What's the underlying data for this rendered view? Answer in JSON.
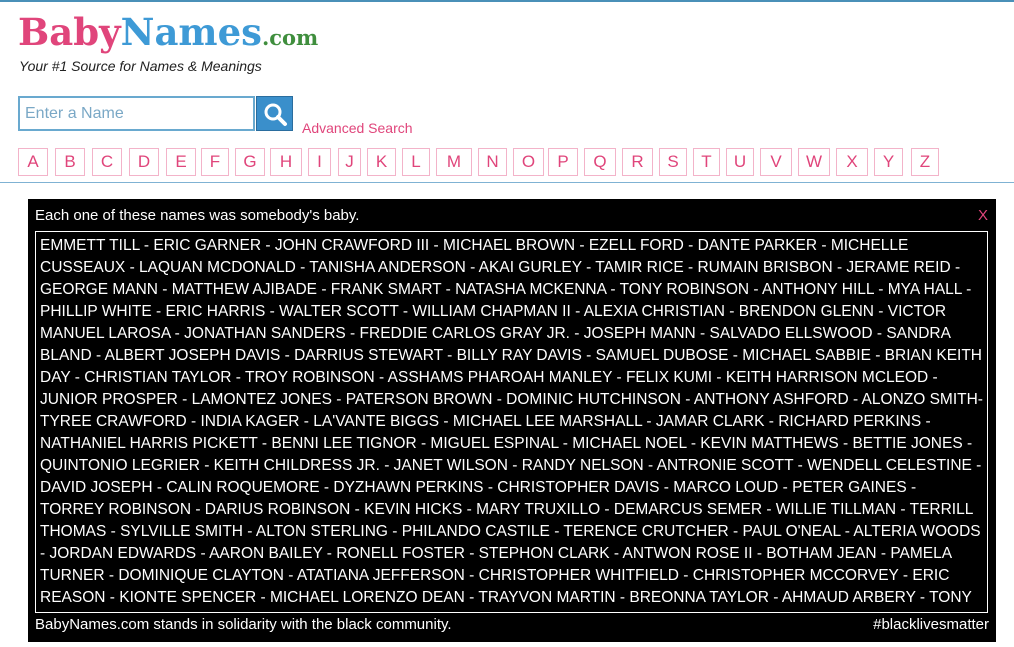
{
  "site": {
    "logo_baby": "Baby",
    "logo_names": "Names",
    "logo_com": ".com",
    "tagline": "Your #1 Source for Names & Meanings"
  },
  "search": {
    "placeholder": "Enter a Name",
    "value": "",
    "button_icon": "search-icon",
    "advanced_label": "Advanced Search"
  },
  "alphabet": [
    "A",
    "B",
    "C",
    "D",
    "E",
    "F",
    "G",
    "H",
    "I",
    "J",
    "K",
    "L",
    "M",
    "N",
    "O",
    "P",
    "Q",
    "R",
    "S",
    "T",
    "U",
    "V",
    "W",
    "X",
    "Y",
    "Z"
  ],
  "memorial": {
    "header": "Each one of these names was somebody's baby.",
    "close_label": "X",
    "names": "EMMETT TILL - ERIC GARNER - JOHN CRAWFORD III - MICHAEL BROWN - EZELL FORD - DANTE PARKER - MICHELLE CUSSEAUX - LAQUAN MCDONALD - TANISHA ANDERSON - AKAI GURLEY - TAMIR RICE - RUMAIN BRISBON - JERAME REID - GEORGE MANN - MATTHEW AJIBADE - FRANK SMART - NATASHA MCKENNA - TONY ROBINSON - ANTHONY HILL - MYA HALL - PHILLIP WHITE - ERIC HARRIS - WALTER SCOTT - WILLIAM CHAPMAN II - ALEXIA CHRISTIAN - BRENDON GLENN - VICTOR MANUEL LAROSA - JONATHAN SANDERS - FREDDIE CARLOS GRAY JR. - JOSEPH MANN - SALVADO ELLSWOOD - SANDRA BLAND - ALBERT JOSEPH DAVIS - DARRIUS STEWART - BILLY RAY DAVIS - SAMUEL DUBOSE - MICHAEL SABBIE - BRIAN KEITH DAY - CHRISTIAN TAYLOR - TROY ROBINSON - ASSHAMS PHAROAH MANLEY - FELIX KUMI - KEITH HARRISON MCLEOD - JUNIOR PROSPER - LAMONTEZ JONES - PATERSON BROWN - DOMINIC HUTCHINSON - ANTHONY ASHFORD - ALONZO SMITH-TYREE CRAWFORD - INDIA KAGER - LA'VANTE BIGGS - MICHAEL LEE MARSHALL - JAMAR CLARK - RICHARD PERKINS - NATHANIEL HARRIS PICKETT - BENNI LEE TIGNOR - MIGUEL ESPINAL - MICHAEL NOEL - KEVIN MATTHEWS - BETTIE JONES - QUINTONIO LEGRIER - KEITH CHILDRESS JR. - JANET WILSON - RANDY NELSON - ANTRONIE SCOTT - WENDELL CELESTINE - DAVID JOSEPH - CALIN ROQUEMORE - DYZHAWN PERKINS - CHRISTOPHER DAVIS - MARCO LOUD - PETER GAINES - TORREY ROBINSON - DARIUS ROBINSON - KEVIN HICKS - MARY TRUXILLO - DEMARCUS SEMER - WILLIE TILLMAN - TERRILL THOMAS - SYLVILLE SMITH - ALTON STERLING - PHILANDO CASTILE - TERENCE CRUTCHER - PAUL O'NEAL - ALTERIA WOODS - JORDAN EDWARDS - AARON BAILEY - RONELL FOSTER - STEPHON CLARK - ANTWON ROSE II - BOTHAM JEAN - PAMELA TURNER - DOMINIQUE CLAYTON - ATATIANA JEFFERSON - CHRISTOPHER WHITFIELD - CHRISTOPHER MCCORVEY - ERIC REASON - KIONTE SPENCER - MICHAEL LORENZO DEAN - TRAYVON MARTIN - BREONNA TAYLOR - AHMAUD ARBERY - TONY MCDADE - GEORGE FLOYD",
    "footer_left": "BabyNames.com stands in solidarity with the black community.",
    "footer_right": "#blacklivesmatter"
  },
  "colors": {
    "pink": "#e0457b",
    "blue": "#3e9ad6",
    "green": "#3f8e3d",
    "memorial_bg": "#000000"
  }
}
